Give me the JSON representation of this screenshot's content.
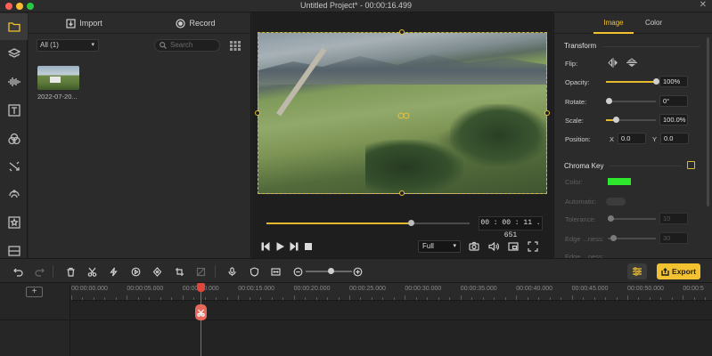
{
  "window": {
    "title": "Untitled Project* - 00:00:16.499",
    "traffic_lights": [
      "#fe5f57",
      "#febc2e",
      "#28c840"
    ]
  },
  "left_rail": {
    "items": [
      {
        "icon": "folder-icon",
        "active": true
      },
      {
        "icon": "layers-icon"
      },
      {
        "icon": "audio-wave-icon"
      },
      {
        "icon": "text-icon"
      },
      {
        "icon": "filters-icon"
      },
      {
        "icon": "transitions-icon"
      },
      {
        "icon": "effects-icon"
      },
      {
        "icon": "elements-star-icon"
      },
      {
        "icon": "split-screen-icon"
      }
    ]
  },
  "media": {
    "tabs": [
      {
        "label": "Import",
        "icon": "import-icon"
      },
      {
        "label": "Record",
        "icon": "record-icon"
      }
    ],
    "filter_value": "All (1)",
    "search_placeholder": "Search",
    "items": [
      {
        "label": "2022-07-20..."
      }
    ]
  },
  "preview": {
    "timecode": "00 : 00 : 11 . 651",
    "progress_fraction": 0.71,
    "zoom_value": "Full"
  },
  "properties": {
    "tabs": [
      "Image",
      "Color"
    ],
    "active_tab": "Image",
    "transform": {
      "heading": "Transform",
      "flip_label": "Flip:",
      "opacity_label": "Opacity:",
      "opacity_value": "100%",
      "opacity_fraction": 1.0,
      "rotate_label": "Rotate:",
      "rotate_value": "0°",
      "rotate_fraction": 0.0,
      "scale_label": "Scale:",
      "scale_value": "100.0%",
      "scale_fraction": 0.2,
      "position_label": "Position:",
      "x_label": "X",
      "x_value": "0.0",
      "y_label": "Y",
      "y_value": "0.0"
    },
    "chroma_key": {
      "heading": "Chroma Key",
      "enabled": false,
      "color_label": "Color:",
      "color_swatch": "#2ee82e",
      "automatic_label": "Automatic:",
      "tolerance_label": "Tolerance:",
      "tolerance_value": "10",
      "tolerance_fraction": 0.0,
      "edge_label": "Edge ...ness:",
      "edge_value": "30",
      "edge_fraction": 0.12,
      "edge2_label": "Edge ...ness:"
    }
  },
  "toolbar": {
    "export_label": "Export",
    "accent": "#f2c230",
    "timeline_zoom_fraction": 0.55
  },
  "timeline": {
    "ticks": [
      "00:00:00.000",
      "00:00:05.000",
      "00:00:10.000",
      "00:00:15.000",
      "00:00:20.000",
      "00:00:25.000",
      "00:00:30.000",
      "00:00:35.000",
      "00:00:40.000",
      "00:00:45.000",
      "00:00:50.000",
      "00:00:5"
    ],
    "playhead_color": "#e0463a"
  }
}
